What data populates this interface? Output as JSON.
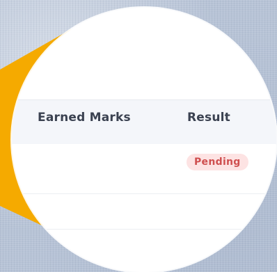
{
  "table": {
    "columns": [
      "Earned Marks",
      "Result"
    ],
    "rows": [
      {
        "earned_marks": "",
        "result": "Pending"
      },
      {
        "earned_marks": "",
        "result": ""
      },
      {
        "earned_marks": "",
        "result": ""
      }
    ]
  },
  "colors": {
    "callout": "#f5aa00",
    "badge_background": "#fde3e3",
    "badge_text": "#cf4f4f",
    "header_background": "#f4f6fa"
  }
}
